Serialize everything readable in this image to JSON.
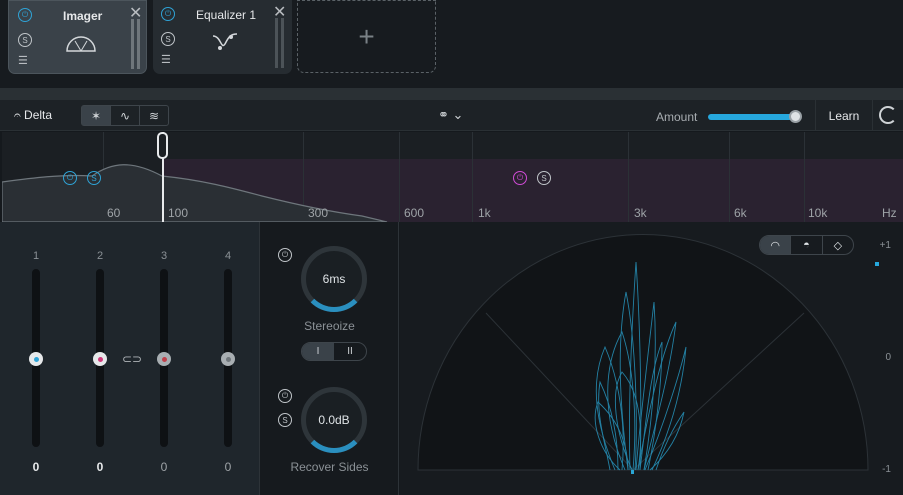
{
  "modules": [
    {
      "title": "Imager",
      "selected": true
    },
    {
      "title": "Equalizer 1",
      "selected": false
    }
  ],
  "module_icons": {
    "power": "power-icon",
    "solo": "S",
    "menu": "list-icon",
    "close": "close-icon"
  },
  "add_slot": {
    "label": "+"
  },
  "toolbar": {
    "delta_label": "Delta",
    "amount_label": "Amount",
    "amount_fraction": 0.95,
    "learn_label": "Learn"
  },
  "spectrum": {
    "freq_labels": [
      "60",
      "100",
      "300",
      "600",
      "1k",
      "3k",
      "6k",
      "10k",
      "Hz"
    ],
    "band_solo": "S"
  },
  "faders": {
    "numbers": [
      "1",
      "2",
      "3",
      "4"
    ],
    "values": [
      "0",
      "0",
      "0",
      "0"
    ],
    "dot_colors": [
      "#2fa3d6",
      "#d0387a",
      "#c0404a",
      "#8a9096"
    ]
  },
  "controls": {
    "stereoize_value": "6ms",
    "stereoize_label": "Stereoize",
    "mode_i": "I",
    "mode_ii": "II",
    "recover_value": "0.0dB",
    "recover_label": "Recover Sides",
    "solo": "S"
  },
  "vectorscope": {
    "correlation": {
      "top": "+1",
      "mid": "0",
      "bottom": "-1"
    }
  },
  "colors": {
    "accent": "#26a8dd",
    "band_magenta": "#d04bd6",
    "trace": "#2aa6d4"
  }
}
